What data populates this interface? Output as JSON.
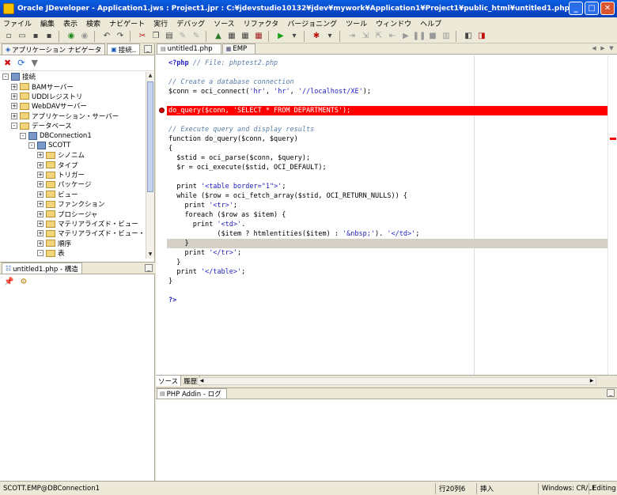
{
  "window": {
    "title": "Oracle JDeveloper - Application1.jws : Project1.jpr : C:¥jdevstudio10132¥jdev¥mywork¥Application1¥Project1¥public_html¥untitled1.php",
    "min": "_",
    "max": "□",
    "close": "✕"
  },
  "menu": [
    "ファイル",
    "編集",
    "表示",
    "検索",
    "ナビゲート",
    "実行",
    "デバッグ",
    "ソース",
    "リファクタ",
    "バージョニング",
    "ツール",
    "ウィンドウ",
    "ヘルプ"
  ],
  "navigator": {
    "tabs": [
      "アプリケーション ナビゲータ",
      "接続.."
    ],
    "tree": [
      {
        "label": "接続",
        "indent": 0,
        "exp": "-",
        "icon": "db"
      },
      {
        "label": "BAMサーバー",
        "indent": 1,
        "exp": "+",
        "icon": "folder"
      },
      {
        "label": "UDDIレジストリ",
        "indent": 1,
        "exp": "+",
        "icon": "folder"
      },
      {
        "label": "WebDAVサーバー",
        "indent": 1,
        "exp": "+",
        "icon": "folder"
      },
      {
        "label": "アプリケーション・サーバー",
        "indent": 1,
        "exp": "+",
        "icon": "folder"
      },
      {
        "label": "データベース",
        "indent": 1,
        "exp": "-",
        "icon": "folder"
      },
      {
        "label": "DBConnection1",
        "indent": 2,
        "exp": "-",
        "icon": "db"
      },
      {
        "label": "SCOTT",
        "indent": 3,
        "exp": "-",
        "icon": "db"
      },
      {
        "label": "シノニム",
        "indent": 4,
        "exp": "+",
        "icon": "folder"
      },
      {
        "label": "タイプ",
        "indent": 4,
        "exp": "+",
        "icon": "folder"
      },
      {
        "label": "トリガー",
        "indent": 4,
        "exp": "+",
        "icon": "folder"
      },
      {
        "label": "パッケージ",
        "indent": 4,
        "exp": "+",
        "icon": "folder"
      },
      {
        "label": "ビュー",
        "indent": 4,
        "exp": "+",
        "icon": "folder"
      },
      {
        "label": "ファンクション",
        "indent": 4,
        "exp": "+",
        "icon": "folder"
      },
      {
        "label": "プロシージャ",
        "indent": 4,
        "exp": "+",
        "icon": "folder"
      },
      {
        "label": "マテリアライズド・ビュー",
        "indent": 4,
        "exp": "+",
        "icon": "folder"
      },
      {
        "label": "マテリアライズド・ビュー・ログ",
        "indent": 4,
        "exp": "+",
        "icon": "folder"
      },
      {
        "label": "順序",
        "indent": 4,
        "exp": "+",
        "icon": "folder"
      },
      {
        "label": "表",
        "indent": 4,
        "exp": "-",
        "icon": "folder"
      }
    ]
  },
  "structure": {
    "tab": "untitled1.php - 構造"
  },
  "editor": {
    "tabs": [
      "untitled1.php",
      "EMP"
    ],
    "bottom_tabs": [
      "ソース",
      "履歴"
    ],
    "lines": [
      {
        "segs": [
          [
            "ph",
            "<?php"
          ],
          [
            "cm",
            " // File: phptest2.php"
          ]
        ]
      },
      {
        "segs": [
          [
            "kw",
            ""
          ]
        ]
      },
      {
        "segs": [
          [
            "cm",
            "// Create a database connection"
          ]
        ]
      },
      {
        "segs": [
          [
            "kw",
            "$conn = oci_connect("
          ],
          [
            "st",
            "'hr'"
          ],
          [
            "kw",
            ", "
          ],
          [
            "st",
            "'hr'"
          ],
          [
            "kw",
            ", "
          ],
          [
            "st",
            "'//localhost/XE'"
          ],
          [
            "kw",
            ");"
          ]
        ]
      },
      {
        "segs": [
          [
            "kw",
            ""
          ]
        ]
      },
      {
        "segs": [
          [
            "bp",
            "do_query($conn, 'SELECT * FROM DEPARTMENTS');"
          ]
        ]
      },
      {
        "segs": [
          [
            "kw",
            ""
          ]
        ]
      },
      {
        "segs": [
          [
            "cm",
            "// Execute query and display results"
          ]
        ]
      },
      {
        "segs": [
          [
            "kw",
            "function do_query($conn, $query)"
          ]
        ]
      },
      {
        "segs": [
          [
            "kw",
            "{"
          ]
        ]
      },
      {
        "segs": [
          [
            "kw",
            "  $stid = oci_parse($conn, $query);"
          ]
        ]
      },
      {
        "segs": [
          [
            "kw",
            "  $r = oci_execute($stid, OCI_DEFAULT);"
          ]
        ]
      },
      {
        "segs": [
          [
            "kw",
            ""
          ]
        ]
      },
      {
        "segs": [
          [
            "kw",
            "  print "
          ],
          [
            "st",
            "'<table border=\"1\">'"
          ],
          [
            "kw",
            ";"
          ]
        ]
      },
      {
        "segs": [
          [
            "kw",
            "  while ($row = oci_fetch_array($stid, OCI_RETURN_NULLS)) {"
          ]
        ]
      },
      {
        "segs": [
          [
            "kw",
            "    print "
          ],
          [
            "st",
            "'<tr>'"
          ],
          [
            "kw",
            ";"
          ]
        ]
      },
      {
        "segs": [
          [
            "kw",
            "    foreach ($row as $item) {"
          ]
        ]
      },
      {
        "segs": [
          [
            "kw",
            "      print "
          ],
          [
            "st",
            "'<td>'"
          ],
          [
            "kw",
            "."
          ]
        ]
      },
      {
        "segs": [
          [
            "kw",
            "            ($item ? htmlentities($item) : "
          ],
          [
            "st",
            "'&nbsp;'"
          ],
          [
            "kw",
            "). "
          ],
          [
            "st",
            "'</td>'"
          ],
          [
            "kw",
            ";"
          ]
        ]
      },
      {
        "segs": [
          [
            "cur",
            "    }"
          ]
        ]
      },
      {
        "segs": [
          [
            "kw",
            "    print "
          ],
          [
            "st",
            "'</tr>'"
          ],
          [
            "kw",
            ";"
          ]
        ]
      },
      {
        "segs": [
          [
            "kw",
            "  }"
          ]
        ]
      },
      {
        "segs": [
          [
            "kw",
            "  print "
          ],
          [
            "st",
            "'</table>'"
          ],
          [
            "kw",
            ";"
          ]
        ]
      },
      {
        "segs": [
          [
            "kw",
            "}"
          ]
        ]
      },
      {
        "segs": [
          [
            "kw",
            ""
          ]
        ]
      },
      {
        "segs": [
          [
            "ph",
            "?>"
          ]
        ]
      }
    ]
  },
  "log": {
    "tab": "PHP Addin - ログ"
  },
  "status": {
    "path": "SCOTT.EMP@DBConnection1",
    "position": "行20列6",
    "mode": "挿入",
    "lineend": "Windows: CR/LF",
    "state": "Editing"
  }
}
